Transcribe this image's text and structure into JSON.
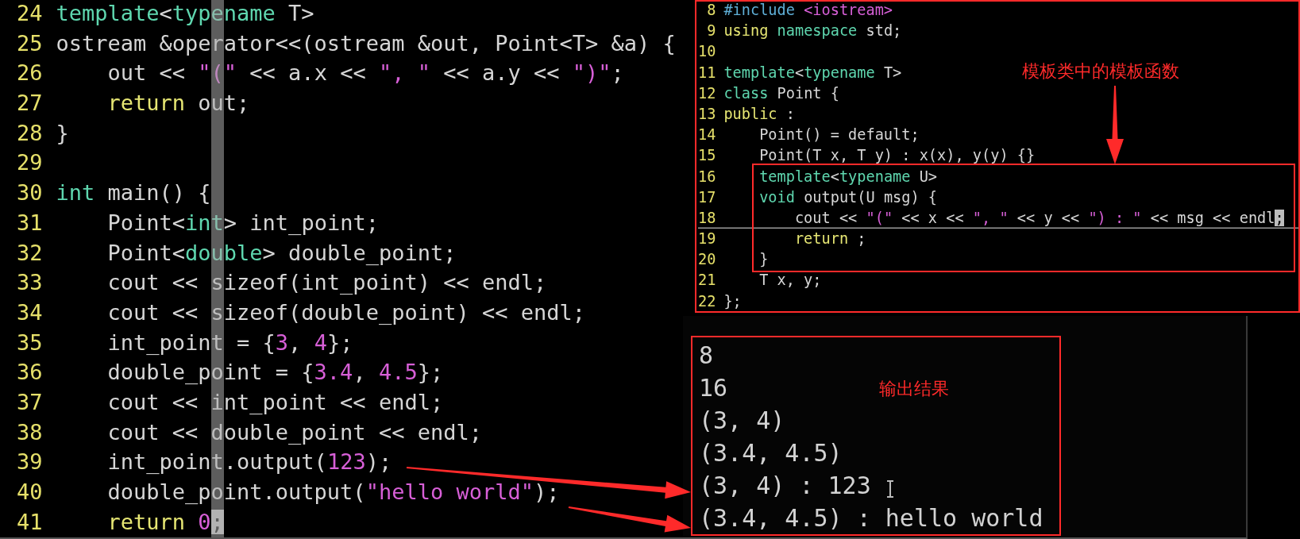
{
  "left_editor": {
    "cursor_column": true,
    "lines": [
      {
        "number": "24",
        "tokens": [
          {
            "kind": "keyword",
            "text": "template"
          },
          {
            "kind": "plain",
            "text": "<"
          },
          {
            "kind": "keyword",
            "text": "typename"
          },
          {
            "kind": "plain",
            "text": " T>"
          }
        ]
      },
      {
        "number": "25",
        "tokens": [
          {
            "kind": "plain",
            "text": "ostream &operator<<(ostream &out, Point<T> &a) {"
          }
        ]
      },
      {
        "number": "26",
        "tokens": [
          {
            "kind": "plain",
            "text": "    out << "
          },
          {
            "kind": "string",
            "text": "\"(\""
          },
          {
            "kind": "plain",
            "text": " << a.x << "
          },
          {
            "kind": "string",
            "text": "\", \""
          },
          {
            "kind": "plain",
            "text": " << a.y << "
          },
          {
            "kind": "string",
            "text": "\")\""
          },
          {
            "kind": "plain",
            "text": ";"
          }
        ]
      },
      {
        "number": "27",
        "tokens": [
          {
            "kind": "statement",
            "text": "    return"
          },
          {
            "kind": "plain",
            "text": " out;"
          }
        ]
      },
      {
        "number": "28",
        "tokens": [
          {
            "kind": "plain",
            "text": "}"
          }
        ]
      },
      {
        "number": "29"
      },
      {
        "number": "30",
        "tokens": [
          {
            "kind": "keyword",
            "text": "int"
          },
          {
            "kind": "plain",
            "text": " main() {"
          }
        ]
      },
      {
        "number": "31",
        "tokens": [
          {
            "kind": "plain",
            "text": "    Point<"
          },
          {
            "kind": "keyword",
            "text": "int"
          },
          {
            "kind": "plain",
            "text": "> int_point;"
          }
        ]
      },
      {
        "number": "32",
        "tokens": [
          {
            "kind": "plain",
            "text": "    Point<"
          },
          {
            "kind": "keyword",
            "text": "double"
          },
          {
            "kind": "plain",
            "text": "> double_point;"
          }
        ]
      },
      {
        "number": "33",
        "tokens": [
          {
            "kind": "plain",
            "text": "    cout << sizeof(int_point) << endl;"
          }
        ]
      },
      {
        "number": "34",
        "tokens": [
          {
            "kind": "plain",
            "text": "    cout << sizeof(double_point) << endl;"
          }
        ]
      },
      {
        "number": "35",
        "tokens": [
          {
            "kind": "plain",
            "text": "    int_point = {"
          },
          {
            "kind": "number",
            "text": "3"
          },
          {
            "kind": "plain",
            "text": ", "
          },
          {
            "kind": "number",
            "text": "4"
          },
          {
            "kind": "plain",
            "text": "};"
          }
        ]
      },
      {
        "number": "36",
        "tokens": [
          {
            "kind": "plain",
            "text": "    double_point = {"
          },
          {
            "kind": "number",
            "text": "3.4"
          },
          {
            "kind": "plain",
            "text": ", "
          },
          {
            "kind": "number",
            "text": "4.5"
          },
          {
            "kind": "plain",
            "text": "};"
          }
        ]
      },
      {
        "number": "37",
        "tokens": [
          {
            "kind": "plain",
            "text": "    cout << int_point << endl;"
          }
        ]
      },
      {
        "number": "38",
        "tokens": [
          {
            "kind": "plain",
            "text": "    cout << double_point << endl;"
          }
        ]
      },
      {
        "number": "39",
        "tokens": [
          {
            "kind": "plain",
            "text": "    int_point.output("
          },
          {
            "kind": "number",
            "text": "123"
          },
          {
            "kind": "plain",
            "text": ");"
          }
        ]
      },
      {
        "number": "40",
        "tokens": [
          {
            "kind": "plain",
            "text": "    double_point.output("
          },
          {
            "kind": "string",
            "text": "\"hello world\""
          },
          {
            "kind": "plain",
            "text": ");"
          }
        ]
      },
      {
        "number": "41",
        "tokens": [
          {
            "kind": "statement",
            "text": "    return"
          },
          {
            "kind": "number",
            "text": " 0"
          },
          {
            "kind": "cursor",
            "text": ";"
          }
        ]
      }
    ]
  },
  "right_editor": {
    "lines": [
      {
        "number": "8",
        "framed": false,
        "current": false,
        "tokens": [
          {
            "kind": "preproc",
            "text": "#include "
          },
          {
            "kind": "string",
            "text": "<iostream>"
          }
        ]
      },
      {
        "number": "9",
        "framed": false,
        "current": false,
        "tokens": [
          {
            "kind": "statement",
            "text": "using "
          },
          {
            "kind": "keyword",
            "text": "namespace"
          },
          {
            "kind": "plain",
            "text": " std;"
          }
        ]
      },
      {
        "number": "10",
        "framed": false,
        "current": false
      },
      {
        "number": "11",
        "framed": false,
        "current": false,
        "tokens": [
          {
            "kind": "keyword",
            "text": "template"
          },
          {
            "kind": "plain",
            "text": "<"
          },
          {
            "kind": "keyword",
            "text": "typename"
          },
          {
            "kind": "plain",
            "text": " T>"
          }
        ]
      },
      {
        "number": "12",
        "framed": false,
        "current": false,
        "tokens": [
          {
            "kind": "keyword",
            "text": "class"
          },
          {
            "kind": "plain",
            "text": " Point {"
          }
        ]
      },
      {
        "number": "13",
        "framed": false,
        "current": false,
        "tokens": [
          {
            "kind": "statement",
            "text": "public"
          },
          {
            "kind": "plain",
            "text": " :"
          }
        ]
      },
      {
        "number": "14",
        "framed": false,
        "current": false,
        "tokens": [
          {
            "kind": "plain",
            "text": "    Point() = default;"
          }
        ]
      },
      {
        "number": "15",
        "framed": false,
        "current": false,
        "tokens": [
          {
            "kind": "plain",
            "text": "    Point(T x, T y) : x(x), y(y) {}"
          }
        ]
      },
      {
        "number": "16",
        "framed": true,
        "current": false,
        "tokens": [
          {
            "kind": "keyword",
            "text": "    template"
          },
          {
            "kind": "plain",
            "text": "<"
          },
          {
            "kind": "keyword",
            "text": "typename"
          },
          {
            "kind": "plain",
            "text": " U>"
          }
        ]
      },
      {
        "number": "17",
        "framed": true,
        "current": false,
        "tokens": [
          {
            "kind": "keyword",
            "text": "    void"
          },
          {
            "kind": "plain",
            "text": " output(U msg) {"
          }
        ]
      },
      {
        "number": "18",
        "framed": true,
        "current": true,
        "tokens": [
          {
            "kind": "plain",
            "text": "        cout << "
          },
          {
            "kind": "string",
            "text": "\"(\""
          },
          {
            "kind": "plain",
            "text": " << x << "
          },
          {
            "kind": "string",
            "text": "\", \""
          },
          {
            "kind": "plain",
            "text": " << y << "
          },
          {
            "kind": "string",
            "text": "\") : \""
          },
          {
            "kind": "plain",
            "text": " << msg << endl"
          },
          {
            "kind": "cursor",
            "text": ";"
          }
        ]
      },
      {
        "number": "19",
        "framed": true,
        "current": false,
        "tokens": [
          {
            "kind": "statement",
            "text": "        return"
          },
          {
            "kind": "plain",
            "text": " ;"
          }
        ]
      },
      {
        "number": "20",
        "framed": true,
        "current": false,
        "tokens": [
          {
            "kind": "plain",
            "text": "    }"
          }
        ]
      },
      {
        "number": "21",
        "framed": false,
        "current": false,
        "tokens": [
          {
            "kind": "plain",
            "text": "    T x, y;"
          }
        ]
      },
      {
        "number": "22",
        "framed": false,
        "current": false,
        "tokens": [
          {
            "kind": "plain",
            "text": "};"
          }
        ]
      }
    ]
  },
  "annotations": [
    {
      "text": "模板类中的模板函数"
    },
    {
      "text": "输出结果"
    }
  ],
  "terminal": {
    "lines": [
      "8",
      "16",
      "(3, 4)",
      "(3.4, 4.5)",
      "(3, 4) : 123",
      "(3.4, 4.5) : hello world"
    ]
  }
}
